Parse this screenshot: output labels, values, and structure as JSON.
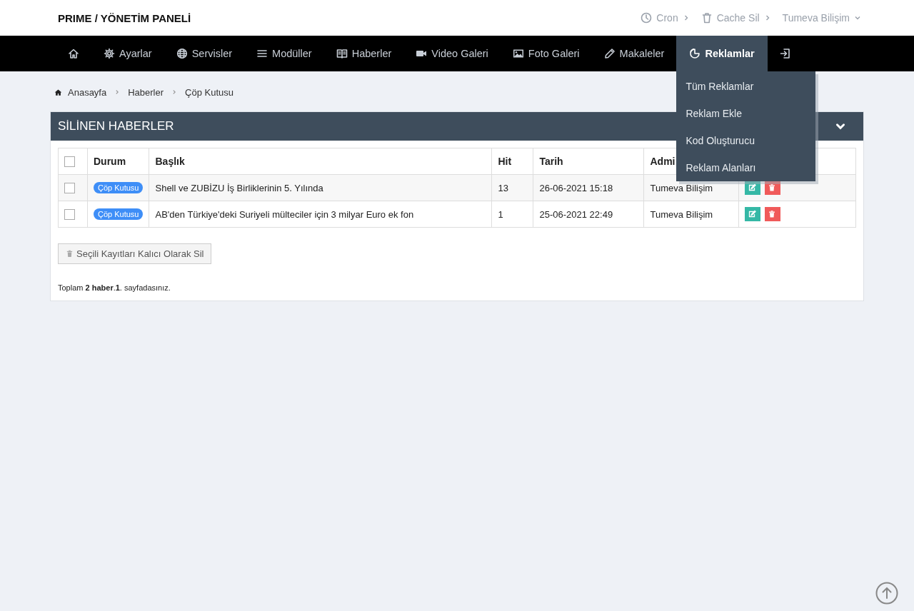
{
  "brand": "PRIME / YÖNETİM PANELİ",
  "top_links": [
    {
      "kind": "cron",
      "label": "Cron"
    },
    {
      "kind": "cache",
      "label": "Cache Sil"
    },
    {
      "kind": "user",
      "label": "Tumeva Bilişim"
    }
  ],
  "nav": [
    {
      "kind": "home",
      "selected": false
    },
    {
      "kind": "gear",
      "label": "Ayarlar",
      "selected": false
    },
    {
      "kind": "globe",
      "label": "Servisler",
      "selected": false
    },
    {
      "kind": "list",
      "label": "Modüller",
      "selected": false
    },
    {
      "kind": "book",
      "label": "Haberler",
      "selected": false
    },
    {
      "kind": "video",
      "label": "Video Galeri",
      "selected": false
    },
    {
      "kind": "image",
      "label": "Foto Galeri",
      "selected": false
    },
    {
      "kind": "pencil",
      "label": "Makaleler",
      "selected": false
    },
    {
      "kind": "pie",
      "label": "Reklamlar",
      "selected": true,
      "expanded": true,
      "menu": [
        "Tüm Reklamlar",
        "Reklam Ekle",
        "Kod Oluşturucu",
        "Reklam Alanları"
      ]
    },
    {
      "kind": "logout",
      "selected": false
    }
  ],
  "breadcrumb": [
    "Anasayfa",
    "Haberler",
    "Çöp Kutusu"
  ],
  "panel": {
    "title": "SİLİNEN HABERLER",
    "table": {
      "all_checked": false,
      "columns": [
        "Durum",
        "Başlık",
        "Hit",
        "Tarih",
        "Admi"
      ],
      "rows": [
        {
          "checked": false,
          "status": "Çöp Kutusu",
          "title": "Shell ve ZUBİZU İş Birliklerinin 5. Yılında",
          "hit": "13",
          "date": "26-06-2021 15:18",
          "admin": "Tumeva Bilişim"
        },
        {
          "checked": false,
          "status": "Çöp Kutusu",
          "title": "AB'den Türkiye'deki Suriyeli mülteciler için 3 milyar Euro ek fon",
          "hit": "1",
          "date": "25-06-2021 22:49",
          "admin": "Tumeva Bilişim"
        }
      ]
    },
    "delete_button": "Seçili Kayıtları Kalıcı Olarak Sil",
    "summary": "Toplam **2 haber**.**1**. sayfadasınız."
  }
}
